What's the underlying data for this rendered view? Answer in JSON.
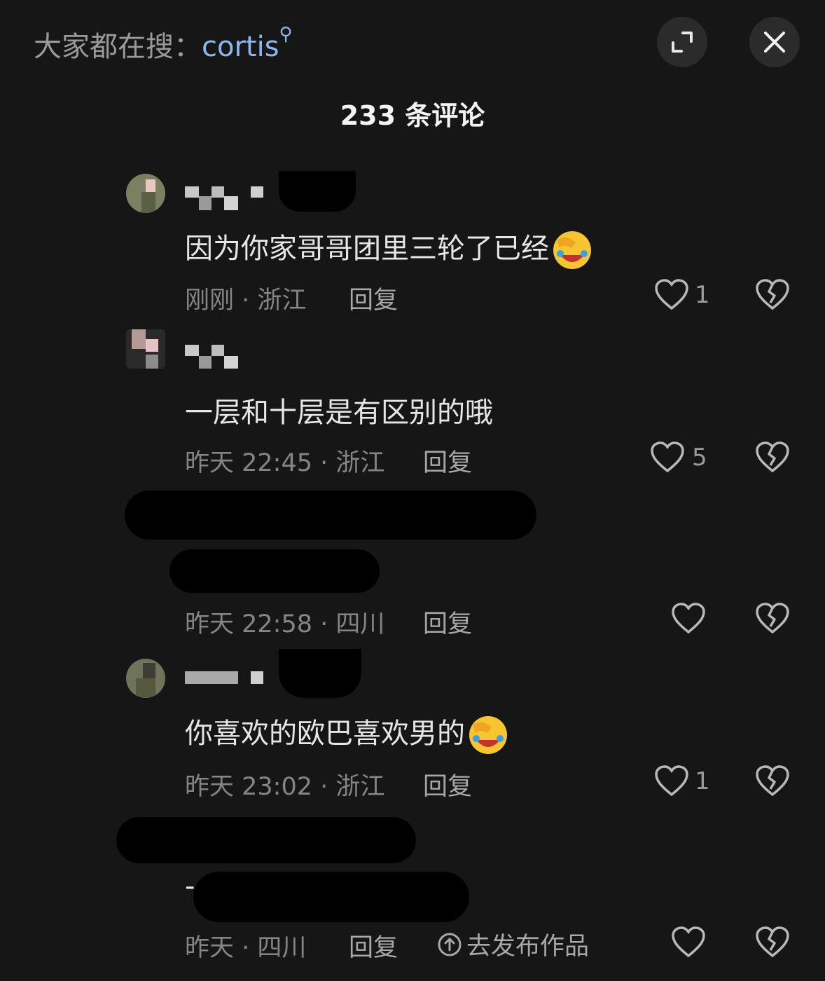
{
  "header": {
    "search_prefix": "大家都在搜：",
    "search_keyword": "cortis",
    "expand_icon": "expand-icon",
    "close_icon": "close-icon"
  },
  "title": "233 条评论",
  "comments": [
    {
      "text": "因为你家哥哥团里三轮了已经",
      "emoji": "face-palm-laughing-emoji",
      "time_location": "刚刚 · 浙江",
      "reply_label": "回复",
      "likes": "1"
    },
    {
      "text": "一层和十层是有区别的哦",
      "time_location": "昨天 22:45 · 浙江",
      "reply_label": "回复",
      "likes": "5"
    },
    {
      "time_location": "昨天 22:58 · 四川",
      "reply_label": "回复",
      "likes": ""
    },
    {
      "text": "你喜欢的欧巴喜欢男的",
      "emoji": "face-palm-laughing-emoji",
      "time_location": "昨天 23:02 · 浙江",
      "reply_label": "回复",
      "likes": "1"
    },
    {
      "text": "-",
      "time_location": "昨天 · 四川",
      "reply_label": "回复",
      "publish_label": "去发布作品",
      "likes": ""
    }
  ],
  "colors": {
    "background": "#161616",
    "accent_keyword": "#8cb6f0",
    "meta_text": "#858585",
    "button_bg": "#2b2b2b"
  }
}
